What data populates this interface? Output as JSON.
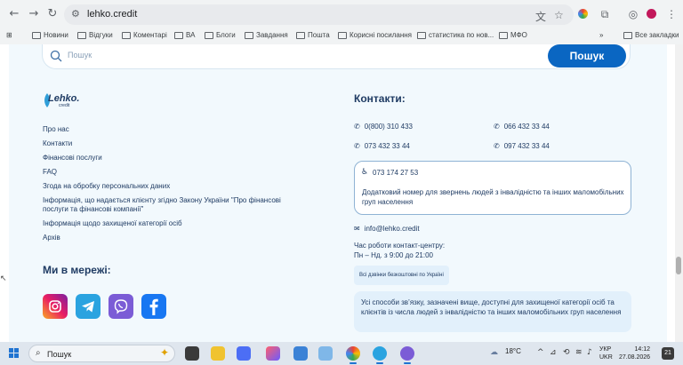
{
  "browser": {
    "url": "lehko.credit",
    "nav": {
      "back": "←",
      "forward": "→",
      "reload": "↻",
      "site_info": "⚙"
    },
    "bookmarks": [
      "Новини",
      "Відгуки",
      "Коментарі",
      "ВА",
      "Блоги",
      "Завдання",
      "Пошта",
      "Корисні посилання",
      "статистика по нов...",
      "МФО"
    ],
    "all_bookmarks": "Все закладки",
    "more": "»",
    "apps_grid": "⊞"
  },
  "search": {
    "placeholder": "Пошук",
    "button": "Пошук"
  },
  "logo": {
    "text": "Lehko.",
    "sub": "credit"
  },
  "links": [
    "Про нас",
    "Контакти",
    "Фінансові послуги",
    "FAQ",
    "Згода на обробку персональних даних",
    "Інформація, що надається клієнту згідно Закону України \"Про фінансові послуги та фінансові компанії\"",
    "Інформація щодо захищеної категорії осіб",
    "Архів"
  ],
  "social": {
    "title": "Ми в мережі:",
    "items": [
      "instagram",
      "telegram",
      "viber",
      "facebook"
    ]
  },
  "contacts": {
    "title": "Контакти:",
    "phones": [
      "0(800) 310 433",
      "066 432 33 44",
      "073 432 33 44",
      "097 432 33 44"
    ],
    "access_phone": "073 174 27 53",
    "access_text": "Додатковий номер для звернень людей з інвалідністю та інших маломобільних груп населення",
    "email": "info@lehko.credit",
    "hours_title": "Час роботи контакт-центру:",
    "hours_value": "Пн – Нд. з 9:00 до 21:00",
    "free_badge": "Всі дзвінки безкоштовні по Україні",
    "info_text": "Усі способи зв’язку, зазначені вище, доступні для захищеної категорії осіб та клієнтів із числа людей з інвалідністю та інших маломобільних груп населення"
  },
  "taskbar": {
    "search": "Пошук",
    "weather": "18°C",
    "lang_top": "УКР",
    "lang_bottom": "UKR",
    "time": "14:12",
    "date": "27.08.2026",
    "notif": "21"
  },
  "colors": {
    "accent": "#0a66c2",
    "text": "#1f3b63",
    "panel": "#f2f9fd"
  }
}
